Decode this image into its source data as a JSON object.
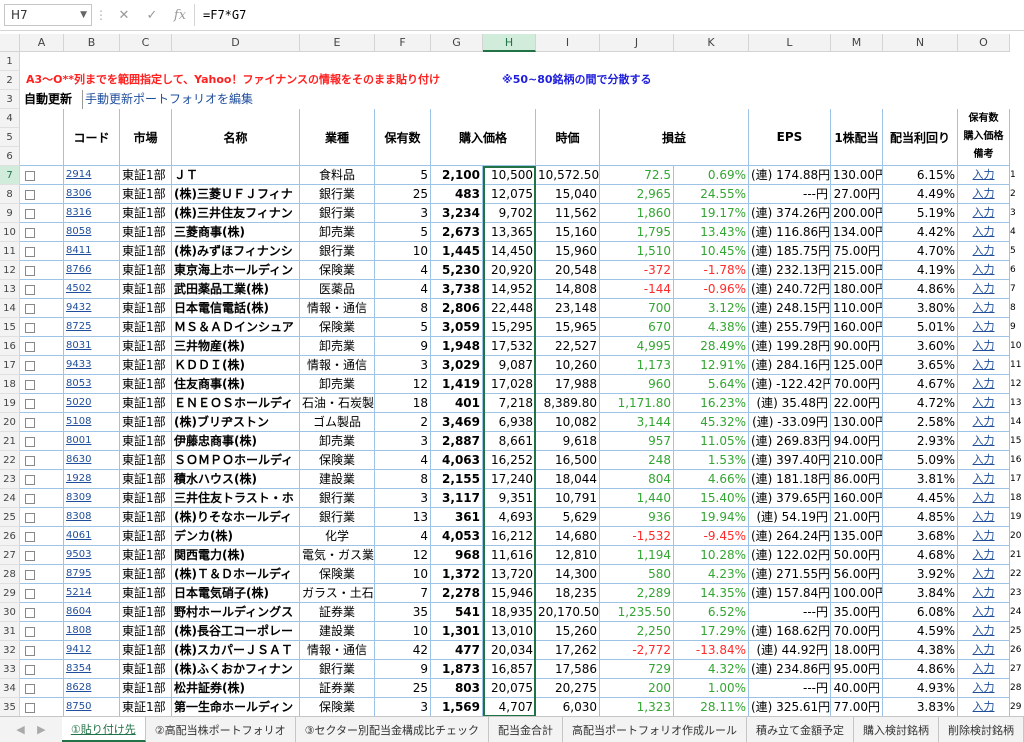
{
  "formula_bar": {
    "name_box": "H7",
    "formula": "=F7*G7"
  },
  "columns": [
    "A",
    "B",
    "C",
    "D",
    "E",
    "F",
    "G",
    "H",
    "I",
    "J",
    "K",
    "L",
    "M",
    "N",
    "O"
  ],
  "selected_column": "H",
  "note": {
    "instruction": "A3～O**列までを範囲指定して、Yahoo！ファイナンスの情報をそのまま貼り付け",
    "diversify": "※50~80銘柄の間で分散する"
  },
  "toolbar": {
    "auto_update": "自動更新",
    "edit_link": "手動更新ポートフォリオを編集"
  },
  "headers": {
    "code": "コード",
    "market": "市場",
    "name": "名称",
    "industry": "業種",
    "shares": "保有数",
    "purchase_price": "購入価格",
    "current_price": "時価",
    "pnl": "損益",
    "eps": "EPS",
    "dividend": "1株配当",
    "yield": "配当利回り",
    "memo1": "保有数",
    "memo2": "購入価格",
    "memo3": "備考"
  },
  "rows": [
    {
      "row": "7",
      "code": "2914",
      "market": "東証1部",
      "name": "ＪＴ",
      "industry": "食料品",
      "shares": "5",
      "price": "2,100",
      "cost": "10,500",
      "current": "10,572.50",
      "pnl": "72.5",
      "pct": "0.69%",
      "neg": false,
      "eps": "(連) 174.88円",
      "div": "130.00円",
      "yield": "6.15%",
      "link": "入力",
      "idx": "1"
    },
    {
      "row": "8",
      "code": "8306",
      "market": "東証1部",
      "name": "(株)三菱ＵＦＪフィナ",
      "industry": "銀行業",
      "shares": "25",
      "price": "483",
      "cost": "12,075",
      "current": "15,040",
      "pnl": "2,965",
      "pct": "24.55%",
      "neg": false,
      "eps": "---円",
      "div": "27.00円",
      "yield": "4.49%",
      "link": "入力",
      "idx": "2"
    },
    {
      "row": "9",
      "code": "8316",
      "market": "東証1部",
      "name": "(株)三井住友フィナン",
      "industry": "銀行業",
      "shares": "3",
      "price": "3,234",
      "cost": "9,702",
      "current": "11,562",
      "pnl": "1,860",
      "pct": "19.17%",
      "neg": false,
      "eps": "(連) 374.26円",
      "div": "200.00円",
      "yield": "5.19%",
      "link": "入力",
      "idx": "3"
    },
    {
      "row": "10",
      "code": "8058",
      "market": "東証1部",
      "name": "三菱商事(株)",
      "industry": "卸売業",
      "shares": "5",
      "price": "2,673",
      "cost": "13,365",
      "current": "15,160",
      "pnl": "1,795",
      "pct": "13.43%",
      "neg": false,
      "eps": "(連) 116.86円",
      "div": "134.00円",
      "yield": "4.42%",
      "link": "入力",
      "idx": "4"
    },
    {
      "row": "11",
      "code": "8411",
      "market": "東証1部",
      "name": "(株)みずほフィナンシ",
      "industry": "銀行業",
      "shares": "10",
      "price": "1,445",
      "cost": "14,450",
      "current": "15,960",
      "pnl": "1,510",
      "pct": "10.45%",
      "neg": false,
      "eps": "(連) 185.75円",
      "div": "75.00円",
      "yield": "4.70%",
      "link": "入力",
      "idx": "5"
    },
    {
      "row": "12",
      "code": "8766",
      "market": "東証1部",
      "name": "東京海上ホールディン",
      "industry": "保険業",
      "shares": "4",
      "price": "5,230",
      "cost": "20,920",
      "current": "20,548",
      "pnl": "-372",
      "pct": "-1.78%",
      "neg": true,
      "eps": "(連) 232.13円",
      "div": "215.00円",
      "yield": "4.19%",
      "link": "入力",
      "idx": "6"
    },
    {
      "row": "13",
      "code": "4502",
      "market": "東証1部",
      "name": "武田薬品工業(株)",
      "industry": "医薬品",
      "shares": "4",
      "price": "3,738",
      "cost": "14,952",
      "current": "14,808",
      "pnl": "-144",
      "pct": "-0.96%",
      "neg": true,
      "eps": "(連) 240.72円",
      "div": "180.00円",
      "yield": "4.86%",
      "link": "入力",
      "idx": "7"
    },
    {
      "row": "14",
      "code": "9432",
      "market": "東証1部",
      "name": "日本電信電話(株)",
      "industry": "情報・通信",
      "shares": "8",
      "price": "2,806",
      "cost": "22,448",
      "current": "23,148",
      "pnl": "700",
      "pct": "3.12%",
      "neg": false,
      "eps": "(連) 248.15円",
      "div": "110.00円",
      "yield": "3.80%",
      "link": "入力",
      "idx": "8"
    },
    {
      "row": "15",
      "code": "8725",
      "market": "東証1部",
      "name": "ＭＳ＆ＡＤインシュア",
      "industry": "保険業",
      "shares": "5",
      "price": "3,059",
      "cost": "15,295",
      "current": "15,965",
      "pnl": "670",
      "pct": "4.38%",
      "neg": false,
      "eps": "(連) 255.79円",
      "div": "160.00円",
      "yield": "5.01%",
      "link": "入力",
      "idx": "9"
    },
    {
      "row": "16",
      "code": "8031",
      "market": "東証1部",
      "name": "三井物産(株)",
      "industry": "卸売業",
      "shares": "9",
      "price": "1,948",
      "cost": "17,532",
      "current": "22,527",
      "pnl": "4,995",
      "pct": "28.49%",
      "neg": false,
      "eps": "(連) 199.28円",
      "div": "90.00円",
      "yield": "3.60%",
      "link": "入力",
      "idx": "10"
    },
    {
      "row": "17",
      "code": "9433",
      "market": "東証1部",
      "name": "ＫＤＤＩ(株)",
      "industry": "情報・通信",
      "shares": "3",
      "price": "3,029",
      "cost": "9,087",
      "current": "10,260",
      "pnl": "1,173",
      "pct": "12.91%",
      "neg": false,
      "eps": "(連) 284.16円",
      "div": "125.00円",
      "yield": "3.65%",
      "link": "入力",
      "idx": "11"
    },
    {
      "row": "18",
      "code": "8053",
      "market": "東証1部",
      "name": "住友商事(株)",
      "industry": "卸売業",
      "shares": "12",
      "price": "1,419",
      "cost": "17,028",
      "current": "17,988",
      "pnl": "960",
      "pct": "5.64%",
      "neg": false,
      "eps": "(連) -122.42円",
      "div": "70.00円",
      "yield": "4.67%",
      "link": "入力",
      "idx": "12"
    },
    {
      "row": "19",
      "code": "5020",
      "market": "東証1部",
      "name": "ＥＮＥＯＳホールディ",
      "industry": "石油・石炭製品",
      "shares": "18",
      "price": "401",
      "cost": "7,218",
      "current": "8,389.80",
      "pnl": "1,171.80",
      "pct": "16.23%",
      "neg": false,
      "eps": "(連) 35.48円",
      "div": "22.00円",
      "yield": "4.72%",
      "link": "入力",
      "idx": "13"
    },
    {
      "row": "20",
      "code": "5108",
      "market": "東証1部",
      "name": "(株)ブリヂストン",
      "industry": "ゴム製品",
      "shares": "2",
      "price": "3,469",
      "cost": "6,938",
      "current": "10,082",
      "pnl": "3,144",
      "pct": "45.32%",
      "neg": false,
      "eps": "(連) -33.09円",
      "div": "130.00円",
      "yield": "2.58%",
      "link": "入力",
      "idx": "14"
    },
    {
      "row": "21",
      "code": "8001",
      "market": "東証1部",
      "name": "伊藤忠商事(株)",
      "industry": "卸売業",
      "shares": "3",
      "price": "2,887",
      "cost": "8,661",
      "current": "9,618",
      "pnl": "957",
      "pct": "11.05%",
      "neg": false,
      "eps": "(連) 269.83円",
      "div": "94.00円",
      "yield": "2.93%",
      "link": "入力",
      "idx": "15"
    },
    {
      "row": "22",
      "code": "8630",
      "market": "東証1部",
      "name": "ＳＯＭＰＯホールディ",
      "industry": "保険業",
      "shares": "4",
      "price": "4,063",
      "cost": "16,252",
      "current": "16,500",
      "pnl": "248",
      "pct": "1.53%",
      "neg": false,
      "eps": "(連) 397.40円",
      "div": "210.00円",
      "yield": "5.09%",
      "link": "入力",
      "idx": "16"
    },
    {
      "row": "23",
      "code": "1928",
      "market": "東証1部",
      "name": "積水ハウス(株)",
      "industry": "建設業",
      "shares": "8",
      "price": "2,155",
      "cost": "17,240",
      "current": "18,044",
      "pnl": "804",
      "pct": "4.66%",
      "neg": false,
      "eps": "(連) 181.18円",
      "div": "86.00円",
      "yield": "3.81%",
      "link": "入力",
      "idx": "17"
    },
    {
      "row": "24",
      "code": "8309",
      "market": "東証1部",
      "name": "三井住友トラスト・ホ",
      "industry": "銀行業",
      "shares": "3",
      "price": "3,117",
      "cost": "9,351",
      "current": "10,791",
      "pnl": "1,440",
      "pct": "15.40%",
      "neg": false,
      "eps": "(連) 379.65円",
      "div": "160.00円",
      "yield": "4.45%",
      "link": "入力",
      "idx": "18"
    },
    {
      "row": "25",
      "code": "8308",
      "market": "東証1部",
      "name": "(株)りそなホールディ",
      "industry": "銀行業",
      "shares": "13",
      "price": "361",
      "cost": "4,693",
      "current": "5,629",
      "pnl": "936",
      "pct": "19.94%",
      "neg": false,
      "eps": "(連) 54.19円",
      "div": "21.00円",
      "yield": "4.85%",
      "link": "入力",
      "idx": "19"
    },
    {
      "row": "26",
      "code": "4061",
      "market": "東証1部",
      "name": "デンカ(株)",
      "industry": "化学",
      "shares": "4",
      "price": "4,053",
      "cost": "16,212",
      "current": "14,680",
      "pnl": "-1,532",
      "pct": "-9.45%",
      "neg": true,
      "eps": "(連) 264.24円",
      "div": "135.00円",
      "yield": "3.68%",
      "link": "入力",
      "idx": "20"
    },
    {
      "row": "27",
      "code": "9503",
      "market": "東証1部",
      "name": "関西電力(株)",
      "industry": "電気・ガス業",
      "shares": "12",
      "price": "968",
      "cost": "11,616",
      "current": "12,810",
      "pnl": "1,194",
      "pct": "10.28%",
      "neg": false,
      "eps": "(連) 122.02円",
      "div": "50.00円",
      "yield": "4.68%",
      "link": "入力",
      "idx": "21"
    },
    {
      "row": "28",
      "code": "8795",
      "market": "東証1部",
      "name": "(株)Ｔ＆Ｄホールディ",
      "industry": "保険業",
      "shares": "10",
      "price": "1,372",
      "cost": "13,720",
      "current": "14,300",
      "pnl": "580",
      "pct": "4.23%",
      "neg": false,
      "eps": "(連) 271.55円",
      "div": "56.00円",
      "yield": "3.92%",
      "link": "入力",
      "idx": "22"
    },
    {
      "row": "29",
      "code": "5214",
      "market": "東証1部",
      "name": "日本電気硝子(株)",
      "industry": "ガラス・土石製品",
      "shares": "7",
      "price": "2,278",
      "cost": "15,946",
      "current": "18,235",
      "pnl": "2,289",
      "pct": "14.35%",
      "neg": false,
      "eps": "(連) 157.84円",
      "div": "100.00円",
      "yield": "3.84%",
      "link": "入力",
      "idx": "23"
    },
    {
      "row": "30",
      "code": "8604",
      "market": "東証1部",
      "name": "野村ホールディングス",
      "industry": "証券業",
      "shares": "35",
      "price": "541",
      "cost": "18,935",
      "current": "20,170.50",
      "pnl": "1,235.50",
      "pct": "6.52%",
      "neg": false,
      "eps": "---円",
      "div": "35.00円",
      "yield": "6.08%",
      "link": "入力",
      "idx": "24"
    },
    {
      "row": "31",
      "code": "1808",
      "market": "東証1部",
      "name": "(株)長谷工コーポレー",
      "industry": "建設業",
      "shares": "10",
      "price": "1,301",
      "cost": "13,010",
      "current": "15,260",
      "pnl": "2,250",
      "pct": "17.29%",
      "neg": false,
      "eps": "(連) 168.62円",
      "div": "70.00円",
      "yield": "4.59%",
      "link": "入力",
      "idx": "25"
    },
    {
      "row": "32",
      "code": "9412",
      "market": "東証1部",
      "name": "(株)スカパーＪＳＡＴ",
      "industry": "情報・通信",
      "shares": "42",
      "price": "477",
      "cost": "20,034",
      "current": "17,262",
      "pnl": "-2,772",
      "pct": "-13.84%",
      "neg": true,
      "eps": "(連) 44.92円",
      "div": "18.00円",
      "yield": "4.38%",
      "link": "入力",
      "idx": "26"
    },
    {
      "row": "33",
      "code": "8354",
      "market": "東証1部",
      "name": "(株)ふくおかフィナン",
      "industry": "銀行業",
      "shares": "9",
      "price": "1,873",
      "cost": "16,857",
      "current": "17,586",
      "pnl": "729",
      "pct": "4.32%",
      "neg": false,
      "eps": "(連) 234.86円",
      "div": "95.00円",
      "yield": "4.86%",
      "link": "入力",
      "idx": "27"
    },
    {
      "row": "34",
      "code": "8628",
      "market": "東証1部",
      "name": "松井証券(株)",
      "industry": "証券業",
      "shares": "25",
      "price": "803",
      "cost": "20,075",
      "current": "20,275",
      "pnl": "200",
      "pct": "1.00%",
      "neg": false,
      "eps": "---円",
      "div": "40.00円",
      "yield": "4.93%",
      "link": "入力",
      "idx": "28"
    },
    {
      "row": "35",
      "code": "8750",
      "market": "東証1部",
      "name": "第一生命ホールディン",
      "industry": "保険業",
      "shares": "3",
      "price": "1,569",
      "cost": "4,707",
      "current": "6,030",
      "pnl": "1,323",
      "pct": "28.11%",
      "neg": false,
      "eps": "(連) 325.61円",
      "div": "77.00円",
      "yield": "3.83%",
      "link": "入力",
      "idx": "29"
    }
  ],
  "sheet_tabs": [
    "①貼り付け先",
    "②高配当株ポートフォリオ",
    "③セクター別配当金構成比チェック",
    "配当金合計",
    "高配当ポートフォリオ作成ルール",
    "積み立て金額予定",
    "購入検討銘柄",
    "削除検討銘柄"
  ],
  "active_tab": 0
}
